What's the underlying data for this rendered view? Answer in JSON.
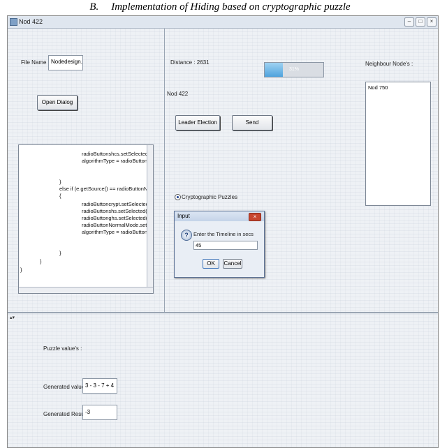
{
  "caption": {
    "section": "B.",
    "text": "Implementation of Hiding based on cryptographic puzzle"
  },
  "window": {
    "title": "Nod 422",
    "controls": {
      "minimize": "–",
      "maximize": "□",
      "close": "×"
    }
  },
  "left_panel": {
    "file_name_label": "File Name :",
    "file_name_value": "Nodedesign.txt",
    "open_dialog_button": "Open Dialog",
    "code_lines": [
      "radioButtonshcs.setSelected(true);",
      "algorithmType = radioButtonshcs.getT",
      "}",
      "else if (e.getSource() == radioButtonNormalMode)",
      "{",
      "radioButtoncrypt.setSelected(false);",
      "radioButtonshs.setSelected(false);",
      "radioButtonghs.setSelected(false);",
      "radioButtonNormalMode.setSelected(tr",
      "algorithmType = radioButtonNormalMo",
      "}",
      "}",
      "}"
    ]
  },
  "center_panel": {
    "distance_label": "Distance : 2631",
    "progress": {
      "percent": 31,
      "label": "31%"
    },
    "node_label": "Nod 422",
    "leader_election_button": "Leader Election",
    "send_button": "Send",
    "radio_label": "Cryptographic Puzzles"
  },
  "right_panel": {
    "neighbours_label": "Neighbour Node's :",
    "neighbours": [
      "Nod 750"
    ]
  },
  "dialog": {
    "title": "Input",
    "prompt": "Enter the Timeline in secs",
    "value": "45",
    "ok_button": "OK",
    "cancel_button": "Cancel",
    "icon": "question-icon"
  },
  "bottom_panel": {
    "collapse_arrows": "▴▾",
    "puzzle_label": "Puzzle value's :",
    "generated_value_label": "Generated value :",
    "generated_value": "3 - 3 - 7 + 4",
    "generated_result_label": "Generated Result :",
    "generated_result": "-3"
  },
  "colors": {
    "accent": "#4fa3dd",
    "window_bg": "#eef1f5",
    "dialog_close": "#c8462f"
  }
}
